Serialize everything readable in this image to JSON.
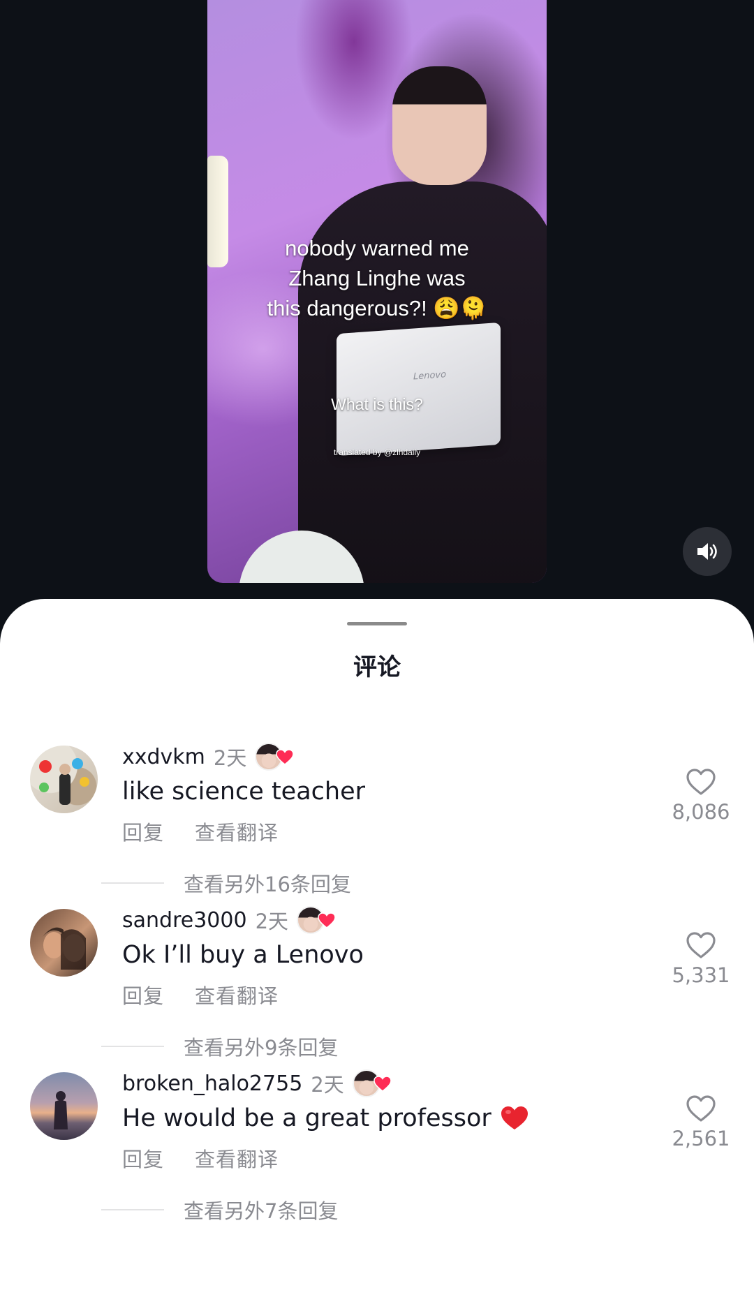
{
  "video": {
    "caption_lines": [
      "nobody warned me",
      "Zhang Linghe was",
      "this dangerous?! 😩🫠"
    ],
    "subtitle": "What is this?",
    "watermark": "translated by @zlhdaily",
    "laptop_brand": "Lenovo"
  },
  "sheet": {
    "title": "评论"
  },
  "comments": [
    {
      "username": "xxdvkm",
      "time": "2天",
      "text": "like science teacher",
      "reply_label": "回复",
      "translate_label": "查看翻译",
      "view_replies": "查看另外16条回复",
      "likes": "8,086"
    },
    {
      "username": "sandre3000",
      "time": "2天",
      "text": "Ok I’ll buy a Lenovo",
      "reply_label": "回复",
      "translate_label": "查看翻译",
      "view_replies": "查看另外9条回复",
      "likes": "5,331"
    },
    {
      "username": "broken_halo2755",
      "time": "2天",
      "text": "He would be a great professor",
      "text_emoji": "red-heart-emoji",
      "reply_label": "回复",
      "translate_label": "查看翻译",
      "view_replies": "查看另外7条回复",
      "likes": "2,561"
    }
  ],
  "colors": {
    "accent_heart": "#fe2c55",
    "secondary_text": "#8a8b91",
    "primary_text": "#161823"
  }
}
